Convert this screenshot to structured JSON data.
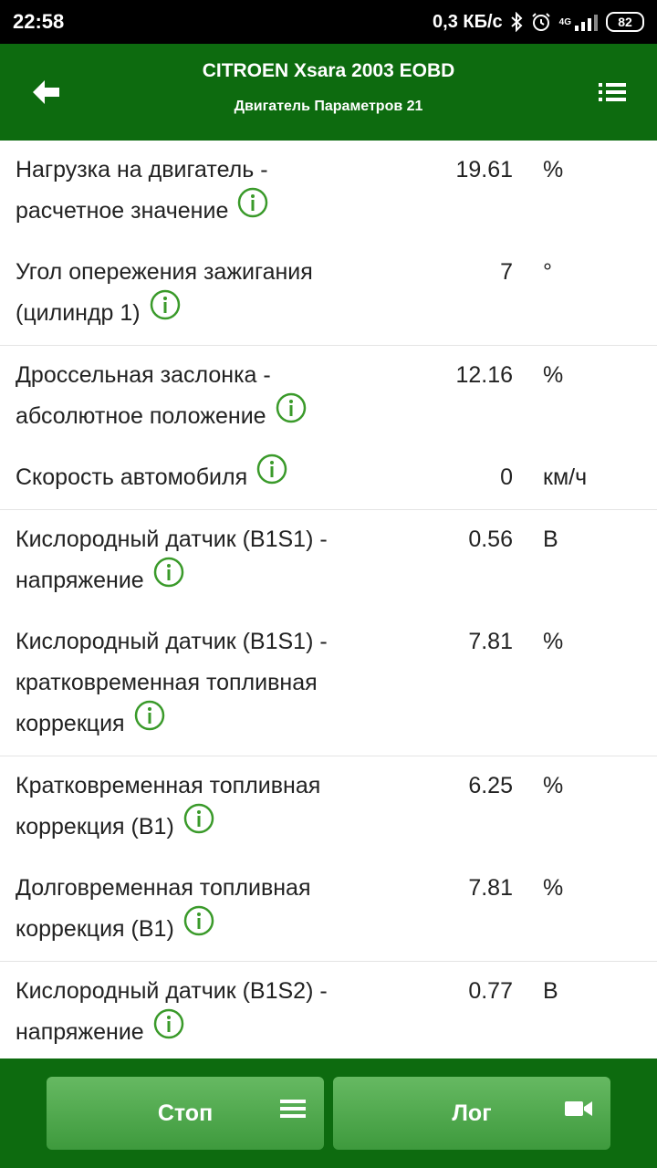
{
  "status_bar": {
    "time": "22:58",
    "network_speed": "0,3 КБ/с",
    "network_type": "4G",
    "battery": "82"
  },
  "app_bar": {
    "title": "CITROEN Xsara 2003 EOBD",
    "subtitle": "Двигатель Параметров 21",
    "back_icon": "arrow-left-icon",
    "menu_icon": "list-menu-icon"
  },
  "colors": {
    "header_bg": "#0d6b0f",
    "info_icon": "#3a9a2a",
    "button_bg": "#4fa94d"
  },
  "parameters": [
    {
      "name": "Нагрузка на двигатель - расчетное значение",
      "value": "19.61",
      "unit": "%"
    },
    {
      "name": "Угол опережения зажигания (цилиндр 1)",
      "value": "7",
      "unit": "°"
    },
    {
      "name": "Дроссельная заслонка - абсолютное положение",
      "value": "12.16",
      "unit": "%"
    },
    {
      "name": "Скорость автомобиля",
      "value": "0",
      "unit": "км/ч"
    },
    {
      "name": "Кислородный датчик (B1S1) - напряжение",
      "value": "0.56",
      "unit": "В"
    },
    {
      "name": "Кислородный датчик (B1S1) - кратковременная топливная коррекция",
      "value": "7.81",
      "unit": "%"
    },
    {
      "name": "Кратковременная топливная коррекция (B1)",
      "value": "6.25",
      "unit": "%"
    },
    {
      "name": "Долговременная топливная коррекция (B1)",
      "value": "7.81",
      "unit": "%"
    },
    {
      "name": "Кислородный датчик (B1S2) - напряжение",
      "value": "0.77",
      "unit": "В"
    }
  ],
  "bottom_bar": {
    "stop_label": "Стоп",
    "stop_icon": "hamburger-icon",
    "log_label": "Лог",
    "log_icon": "video-camera-icon"
  }
}
